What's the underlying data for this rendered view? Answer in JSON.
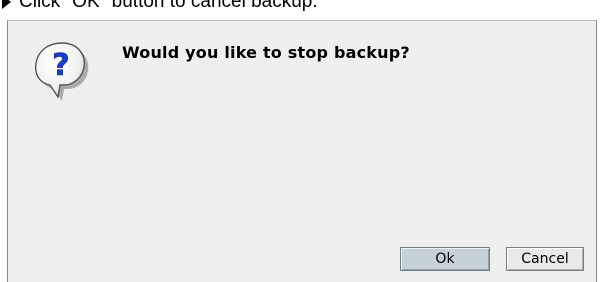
{
  "instruction": {
    "text": "Click \"OK\" button to cancel backup."
  },
  "dialog": {
    "message": "Would you like to stop backup?",
    "icon": "question-bubble-icon",
    "buttons": {
      "ok_label": "Ok",
      "cancel_label": "Cancel"
    }
  },
  "colors": {
    "dialog_bg": "#efefef",
    "ok_button_bg": "#c6d2d8",
    "question_mark": "#1a3fcf"
  }
}
